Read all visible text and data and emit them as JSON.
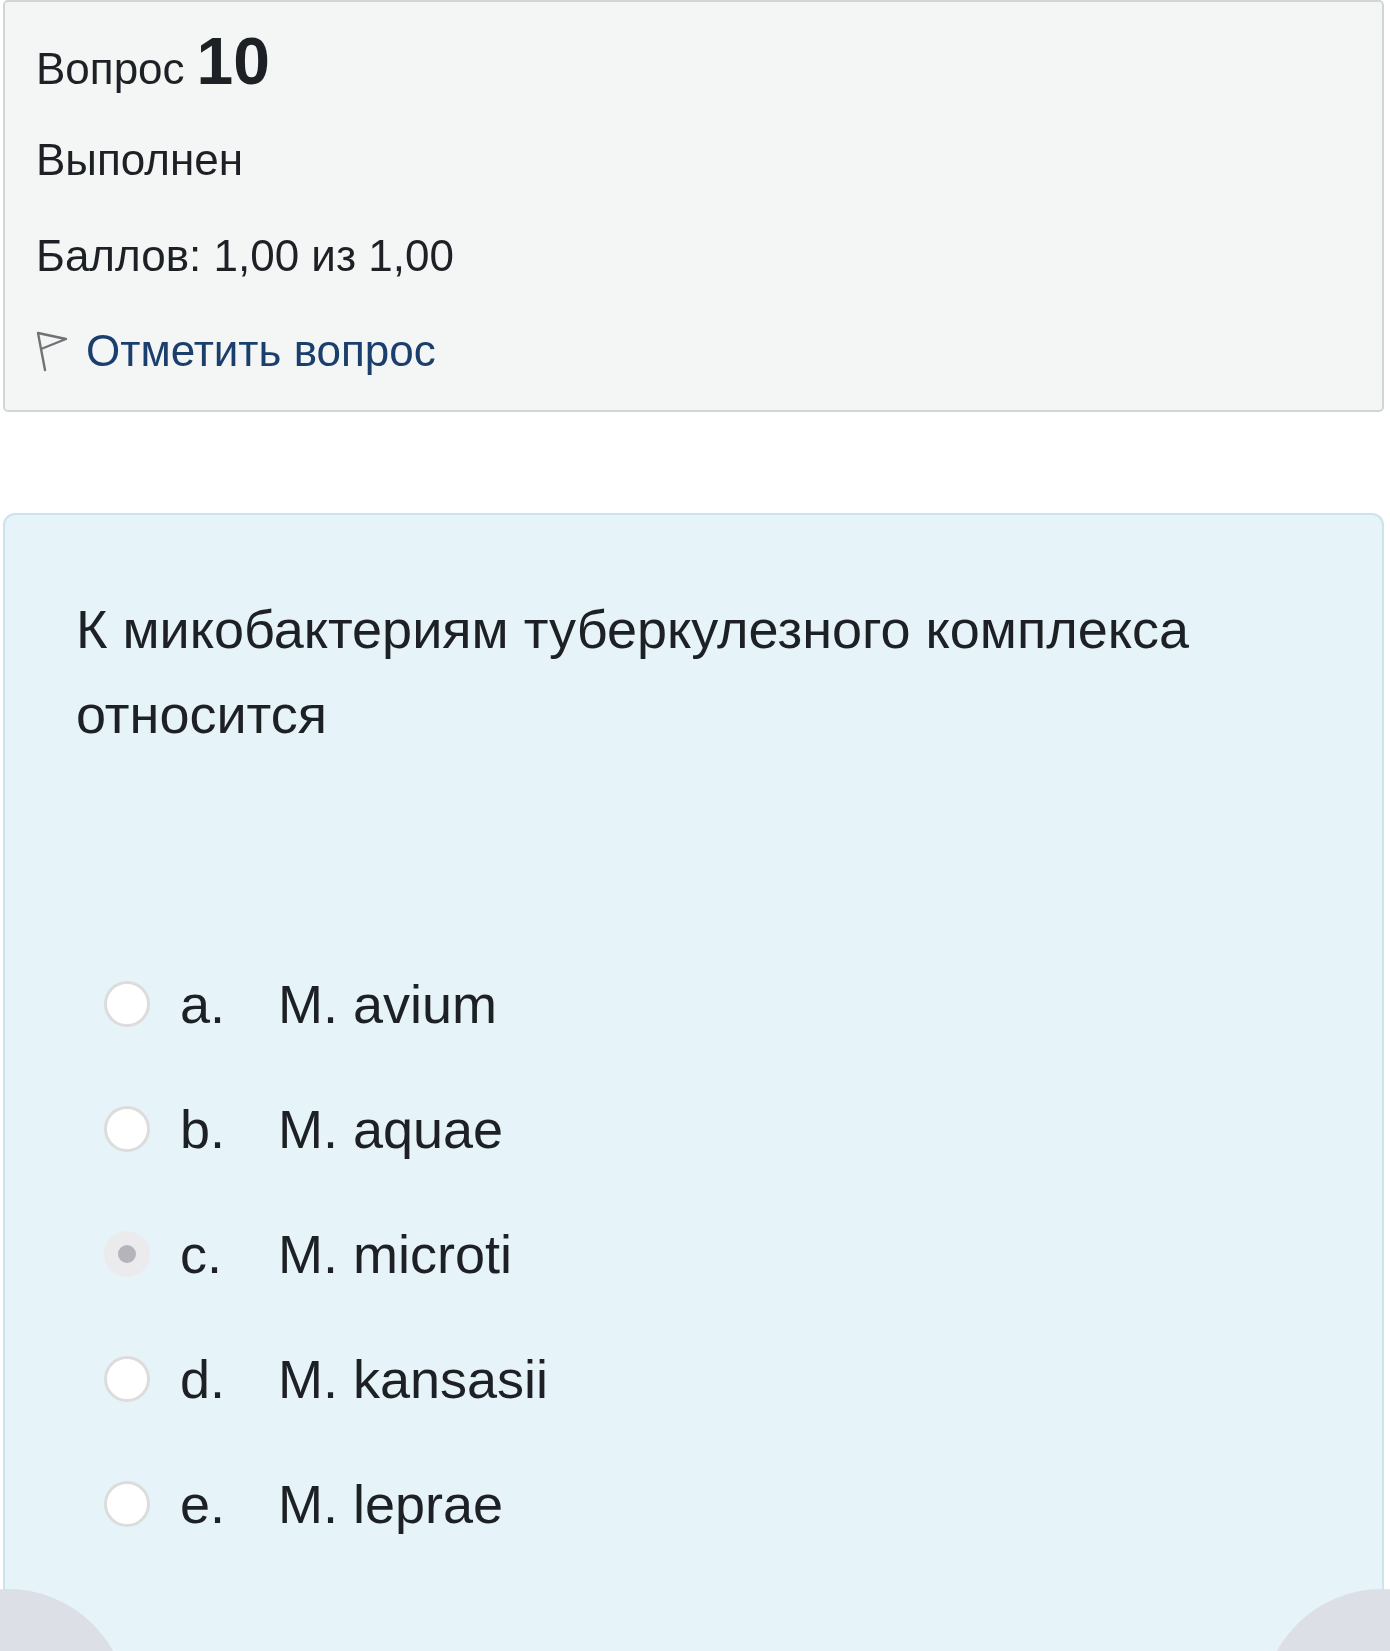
{
  "question_info": {
    "label": "Вопрос",
    "number": "10",
    "status": "Выполнен",
    "grade": "Баллов: 1,00 из 1,00",
    "flag_link": "Отметить вопрос"
  },
  "question": {
    "text": "К микобактериям туберкулезного комплекса относится",
    "options": [
      {
        "letter": "a.",
        "text": "M. avium",
        "selected": false
      },
      {
        "letter": "b.",
        "text": "M. aquae",
        "selected": false
      },
      {
        "letter": "c.",
        "text": "M. microti",
        "selected": true
      },
      {
        "letter": "d.",
        "text": "M. kansasii",
        "selected": false
      },
      {
        "letter": "e.",
        "text": "M. leprae",
        "selected": false
      }
    ]
  }
}
